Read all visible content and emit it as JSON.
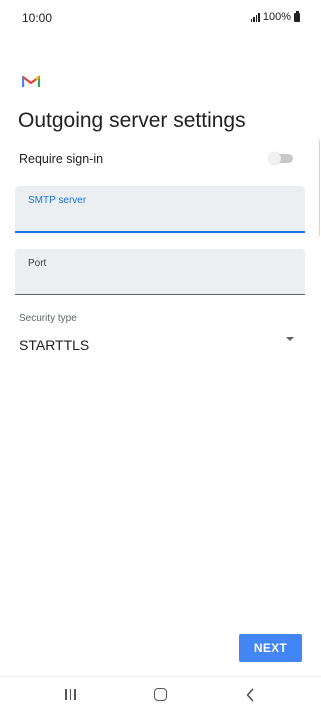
{
  "status_bar": {
    "time": "10:00",
    "battery_text": "100%"
  },
  "header": {
    "app_icon": "gmail-icon",
    "title": "Outgoing server settings"
  },
  "require_signin": {
    "label": "Require sign-in",
    "enabled": false
  },
  "smtp_server": {
    "label": "SMTP server",
    "value": ""
  },
  "port": {
    "label": "Port",
    "value": ""
  },
  "security_type": {
    "label": "Security type",
    "value": "STARTTLS"
  },
  "footer": {
    "next_label": "NEXT"
  },
  "nav": {
    "recents_icon": "recents-icon",
    "home_icon": "home-icon",
    "back_icon": "back-icon"
  },
  "colors": {
    "accent": "#1a73e8",
    "button": "#4285f4",
    "field_bg": "#eceff1"
  }
}
